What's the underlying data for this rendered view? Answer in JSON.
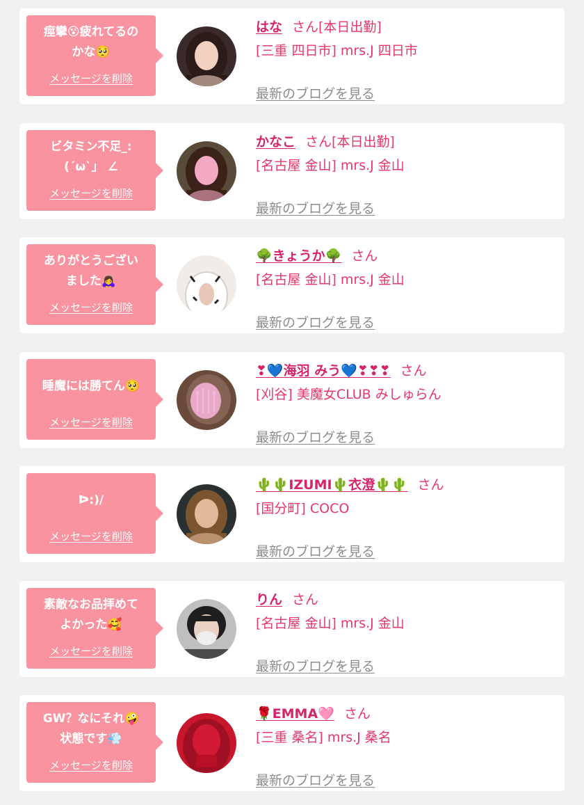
{
  "messages": [
    {
      "bubble_text": "痙攣😵疲れてるの\nかな🥺",
      "delete_label": "メッセージを削除",
      "name": "はな",
      "suffix": "さん[本日出勤]",
      "shop": "[三重 四日市] mrs.J 四日市",
      "blog_label": "最新のブログを見る",
      "avatar_icon": "woman-portrait-photo",
      "colors": {
        "bg": "#3a2a2a",
        "face": "#f1d2c2",
        "hair": "#2b1c1a"
      }
    },
    {
      "bubble_text": "ビタミン不足_:\n(´ω`」 ∠",
      "delete_label": "メッセージを削除",
      "name": "かなこ",
      "suffix": "さん[本日出勤]",
      "shop": "[名古屋 金山] mrs.J 金山",
      "blog_label": "最新のブログを見る",
      "avatar_icon": "woman-portrait-photo",
      "colors": {
        "bg": "#5a4a3a",
        "face": "#f3a9c2",
        "hair": "#3a2218"
      }
    },
    {
      "bubble_text": "ありがとうござい\nました🙇‍♀️",
      "delete_label": "メッセージを削除",
      "name": "🌳きょうか🌳",
      "suffix": "さん",
      "shop": "[名古屋 金山] mrs.J 金山",
      "blog_label": "最新のブログを見る",
      "avatar_icon": "outfit-photo",
      "colors": {
        "bg": "#f2ece8",
        "face": "#e9c7b6",
        "hair": "#ffffff"
      }
    },
    {
      "bubble_text": "睡魔には勝てん🥺",
      "delete_label": "メッセージを削除",
      "name": "❣💙海羽 みう💙❣❣❣",
      "suffix": "さん",
      "shop": "[刈谷] 美魔女CLUB みしゅらん",
      "blog_label": "最新のブログを見る",
      "avatar_icon": "blurred-portrait-photo",
      "colors": {
        "bg": "#6a4a3a",
        "face": "#e8a8c8",
        "hair": "#8a6a5a"
      }
    },
    {
      "bubble_text": "ᐅ:)/",
      "delete_label": "メッセージを削除",
      "name": "🌵🌵IZUMI🌵衣澄🌵🌵",
      "suffix": "さん",
      "shop": "[国分町] COCO",
      "blog_label": "最新のブログを見る",
      "avatar_icon": "woman-portrait-photo",
      "colors": {
        "bg": "#2a3030",
        "face": "#e2b99a",
        "hair": "#7a5530"
      }
    },
    {
      "bubble_text": "素敵なお品拝めて\nよかった🥰",
      "delete_label": "メッセージを削除",
      "name": "りん",
      "suffix": "さん",
      "shop": "[名古屋 金山] mrs.J 金山",
      "blog_label": "最新のブログを見る",
      "avatar_icon": "masked-portrait-photo",
      "colors": {
        "bg": "#bfbfbf",
        "face": "#eeeeee",
        "hair": "#1e1e1e"
      }
    },
    {
      "bubble_text": "GW？なにそれ🤪\n状態です💨",
      "delete_label": "メッセージを削除",
      "name": "🌹EMMA🩷",
      "suffix": "さん",
      "shop": "[三重 桑名] mrs.J 桑名",
      "blog_label": "最新のブログを見る",
      "avatar_icon": "red-hoodie-photo",
      "colors": {
        "bg": "#c8162c",
        "face": "#d21a34",
        "hair": "#a01024"
      }
    }
  ],
  "colors": {
    "page_bg": "#f1f1f1",
    "bubble_pink": "#f8939f",
    "name_pink": "#d6246a",
    "text_pink": "#e8376a",
    "link_gray": "#8c8c8c"
  }
}
